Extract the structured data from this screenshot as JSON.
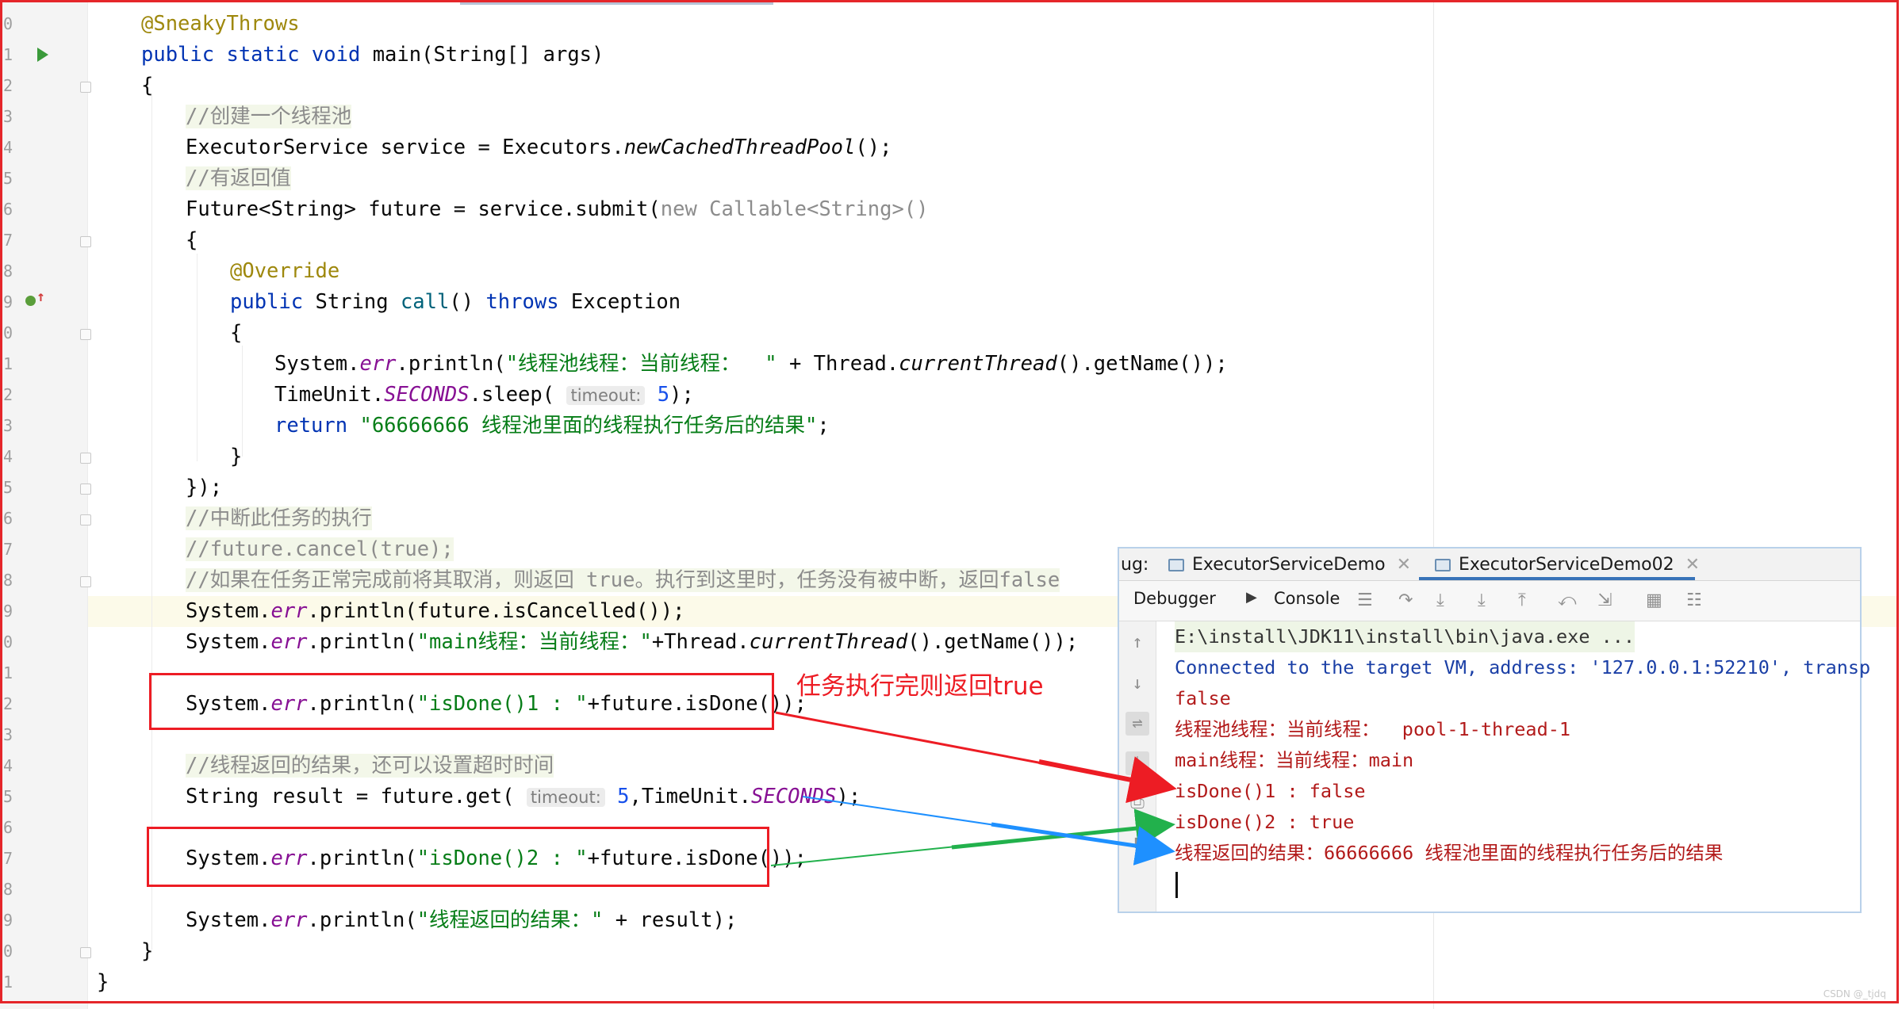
{
  "gutter": {
    "line_numbers": [
      "0",
      "1",
      "2",
      "3",
      "4",
      "5",
      "6",
      "7",
      "8",
      "9",
      "0",
      "1",
      "2",
      "3",
      "4",
      "5",
      "6",
      "7",
      "8",
      "9",
      "0",
      "1",
      "2",
      "3",
      "4",
      "5",
      "6",
      "7",
      "8",
      "9",
      "0",
      "1"
    ]
  },
  "code": {
    "l0": "@SneakyThrows",
    "l1a": "public static void",
    "l1b": " main(String[] args)",
    "l2": "{",
    "l3": "//创建一个线程池",
    "l4a": "ExecutorService service = Executors.",
    "l4b": "newCachedThreadPool",
    "l4c": "();",
    "l5": "//有返回值",
    "l6a": "Future<String> future = service.submit(",
    "l6b": "new Callable<String>()",
    "l7": "{",
    "l8": "@Override",
    "l9a": "public",
    "l9b": " String ",
    "l9c": "call",
    "l9d": "() ",
    "l9e": "throws",
    "l9f": " Exception",
    "l10": "{",
    "l11a": "System.",
    "l11b": "err",
    "l11c": ".println(",
    "l11d": "\"线程池线程：当前线程：  \"",
    "l11e": " + Thread.",
    "l11f": "currentThread",
    "l11g": "().getName());",
    "l12a": "TimeUnit.",
    "l12b": "SECONDS",
    "l12c": ".sleep( ",
    "l12hint": "timeout:",
    "l12d": " 5",
    "l12e": ");",
    "l13a": "return",
    "l13b": " \"66666666 线程池里面的线程执行任务后的结果\"",
    "l13c": ";",
    "l14": "}",
    "l15": "});",
    "l16": "//中断此任务的执行",
    "l17": "//future.cancel(true);",
    "l18": "//如果在任务正常完成前将其取消，则返回 true。执行到这里时，任务没有被中断，返回false",
    "l19a": "System.",
    "l19b": "err",
    "l19c": ".println(future.isCancelled());",
    "l20a": "System.",
    "l20b": "err",
    "l20c": ".println(",
    "l20d": "\"main线程：当前线程：\"",
    "l20e": "+Thread.",
    "l20f": "currentThread",
    "l20g": "().getName());",
    "l22a": "System.",
    "l22b": "err",
    "l22c": ".println(",
    "l22d": "\"isDone()1 : \"",
    "l22e": "+future.isDone());",
    "l24": "//线程返回的结果，还可以设置超时时间",
    "l25a": "String result = future.get( ",
    "l25hint": "timeout:",
    "l25b": " 5",
    "l25c": ",TimeUnit.",
    "l25d": "SECONDS",
    "l25e": ");",
    "l27a": "System.",
    "l27b": "err",
    "l27c": ".println(",
    "l27d": "\"isDone()2 : \"",
    "l27e": "+future.isDone());",
    "l29a": "System.",
    "l29b": "err",
    "l29c": ".println(",
    "l29d": "\"线程返回的结果：\"",
    "l29e": " + result);",
    "l30": "}",
    "l31": "}"
  },
  "annotation": {
    "label": "任务执行完则返回true"
  },
  "console": {
    "tab_prefix": "ug:",
    "tab1": "ExecutorServiceDemo",
    "tab2": "ExecutorServiceDemo02",
    "debugger_label": "Debugger",
    "console_label": "Console",
    "lines": [
      "E:\\install\\JDK11\\install\\bin\\java.exe ...",
      "Connected to the target VM, address: '127.0.0.1:52210', transp",
      "false",
      "线程池线程：当前线程：  pool-1-thread-1",
      "main线程：当前线程：main",
      "isDone()1 : false",
      "isDone()2 : true",
      "线程返回的结果：66666666 线程池里面的线程执行任务后的结果"
    ]
  },
  "colors": {
    "frame": "#e5262a",
    "arrow_red": "#ed1c24",
    "arrow_green": "#22b14c",
    "arrow_blue": "#1e90ff",
    "keyword": "#0033b3",
    "string": "#067d17",
    "static_field": "#871094"
  },
  "watermark": "CSDN @_tjdq"
}
